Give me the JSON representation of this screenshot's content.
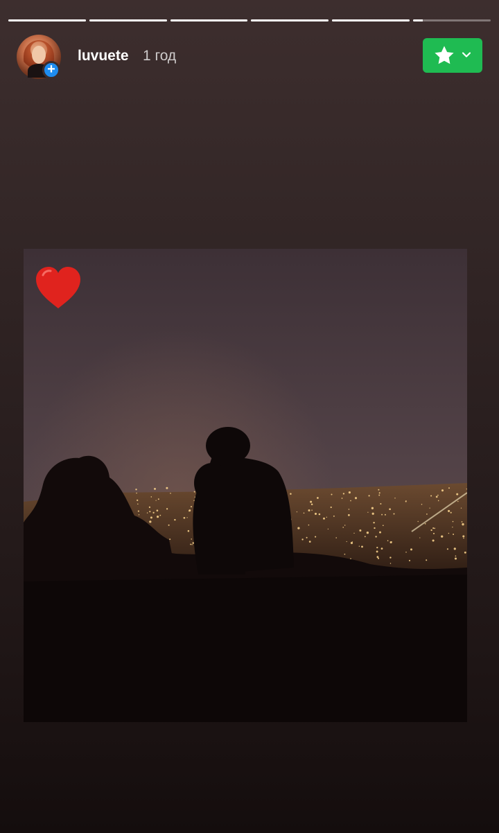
{
  "story": {
    "username": "luvuete",
    "time_ago": "1 год",
    "progress_segments": [
      1,
      1,
      1,
      1,
      1,
      0.12
    ]
  },
  "icons": {
    "avatar_badge": "plus-icon",
    "favorite_button": "star-icon",
    "favorite_dropdown": "chevron-down-icon",
    "sticker": "red-heart-icon"
  },
  "colors": {
    "favorite_button": "#1fbb52",
    "badge": "#1e8cf0",
    "heart": "#e0231e"
  }
}
